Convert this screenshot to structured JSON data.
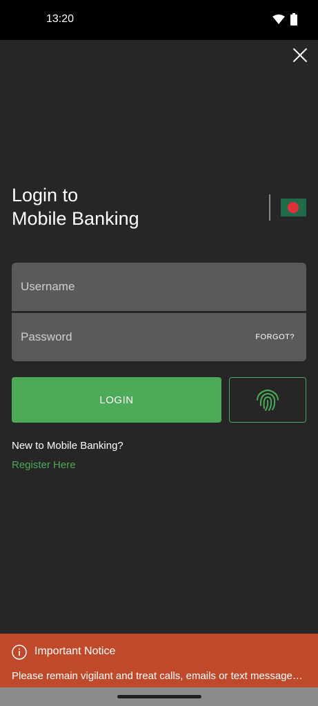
{
  "status_bar": {
    "time": "13:20",
    "icons": [
      "wifi-icon",
      "battery-icon"
    ]
  },
  "header": {
    "close_icon": "close-icon"
  },
  "title": {
    "line1": "Login to",
    "line2": "Mobile Banking"
  },
  "region": {
    "flag_icon": "bangladesh-flag-icon"
  },
  "form": {
    "username_placeholder": "Username",
    "password_placeholder": "Password",
    "forgot_label": "FORGOT?",
    "login_label": "LOGIN",
    "fingerprint_icon": "fingerprint-icon"
  },
  "register": {
    "prompt": "New to Mobile Banking?",
    "link": "Register Here"
  },
  "notice": {
    "icon": "info-icon",
    "title": "Important Notice",
    "body": "Please remain vigilant and treat calls, emails or text messages with caution"
  },
  "colors": {
    "background": "#262626",
    "accent_green": "#4caa59",
    "field_bg": "#5a5a5a",
    "notice_bg": "#bf4a2b",
    "flag_green": "#1f6b4a",
    "flag_red": "#e0303a"
  }
}
